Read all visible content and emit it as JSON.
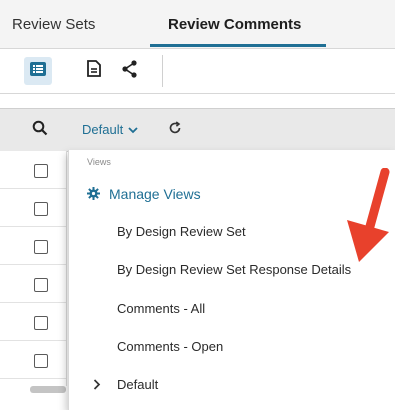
{
  "tabs": [
    {
      "label": "Review Sets",
      "active": false
    },
    {
      "label": "Review Comments",
      "active": true
    }
  ],
  "toolbar": {
    "icons": [
      "list-view-icon",
      "document-icon",
      "share-icon"
    ]
  },
  "filter_bar": {
    "view_selected": "Default"
  },
  "dropdown": {
    "header": "Views",
    "manage_label": "Manage Views",
    "items": [
      "By Design Review Set",
      "By Design Review Set Response Details",
      "Comments - All",
      "Comments - Open"
    ],
    "group_label": "Default"
  },
  "colors": {
    "accent": "#1f6f94",
    "annotation_arrow": "#e8412c"
  }
}
